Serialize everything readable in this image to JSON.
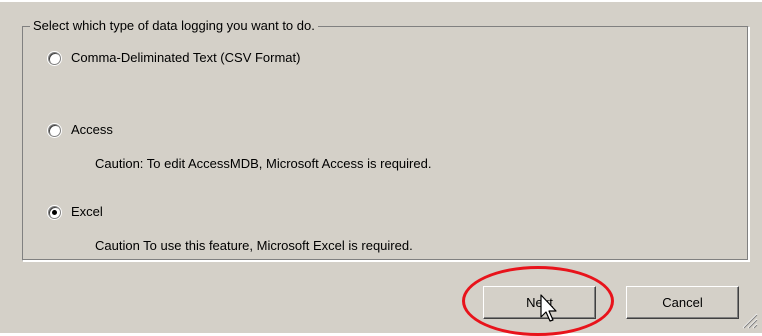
{
  "dialog": {
    "group_title": "Select which type of data logging you want to do.",
    "options": [
      {
        "label": "Comma-Deliminated Text (CSV Format)",
        "checked": false
      },
      {
        "label": "Access",
        "checked": false,
        "caution": "Caution: To edit AccessMDB, Microsoft Access is required."
      },
      {
        "label": "Excel",
        "checked": true,
        "caution": "Caution  To use this feature, Microsoft Excel is required."
      }
    ],
    "buttons": {
      "next_label": "Next",
      "cancel_label": "Cancel"
    }
  },
  "colors": {
    "dialog_face": "#d4d0c8",
    "highlight_ring": "#e8131b"
  },
  "icons": [
    "radio-button-icon",
    "mouse-pointer-icon",
    "resize-grip-icon"
  ]
}
